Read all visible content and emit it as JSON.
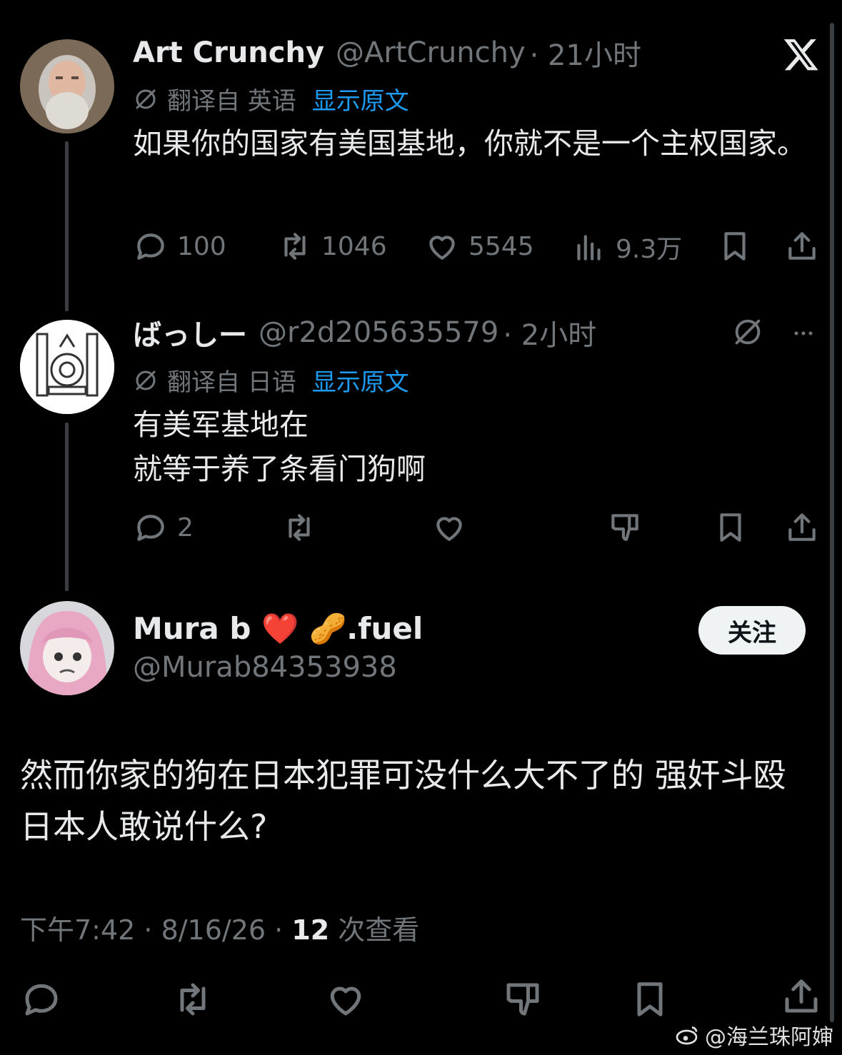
{
  "tweet1": {
    "name": "Art Crunchy",
    "handle": "@ArtCrunchy",
    "time": "· 21小时",
    "translated_from": "翻译自 英语",
    "show_original": "显示原文",
    "text": "如果你的国家有美国基地，你就不是一个主权国家。",
    "replies": "100",
    "reposts": "1046",
    "likes": "5545",
    "views": "9.3万"
  },
  "tweet2": {
    "name": "ばっしー",
    "handle": "@r2d205635579",
    "time": "· 2小时",
    "translated_from": "翻译自 日语",
    "show_original": "显示原文",
    "text_line1": "有美军基地在",
    "text_line2": "就等于养了条看门狗啊",
    "replies": "2"
  },
  "main": {
    "name": "Mura b ❤️ 🥜.fuel",
    "handle": "@Murab84353938",
    "follow": "关注",
    "text": "然而你家的狗在日本犯罪可没什么大不了的 强奸斗殴  日本人敢说什么?",
    "time": "下午7:42 · 8/16/26 · ",
    "views_count": "12",
    "views_label": " 次查看"
  },
  "watermark": "@海兰珠阿婶",
  "colors": {
    "background": "#000000",
    "text": "#e7e9ea",
    "muted": "#71767b",
    "link": "#1d9bf0"
  }
}
